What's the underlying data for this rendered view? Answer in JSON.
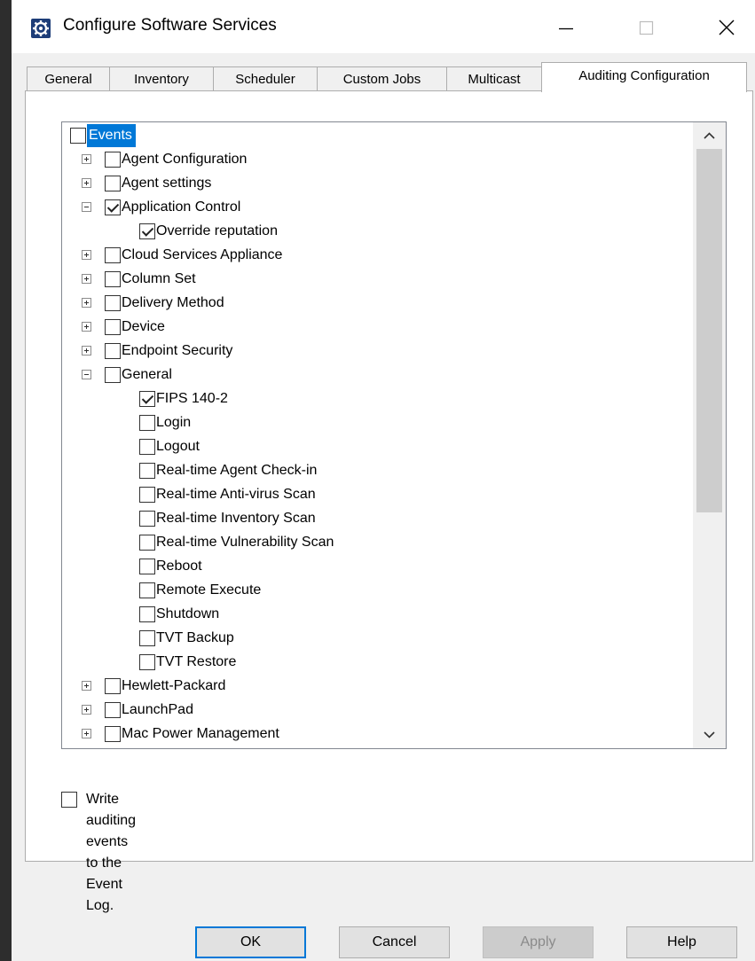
{
  "window": {
    "title": "Configure Software Services",
    "controls": {
      "minimize": "minimize-icon",
      "maximize": "maximize-icon",
      "close": "close-icon"
    }
  },
  "tabs": [
    {
      "label": "General"
    },
    {
      "label": "Inventory"
    },
    {
      "label": "Scheduler"
    },
    {
      "label": "Custom Jobs"
    },
    {
      "label": "Multicast"
    },
    {
      "label": "Auditing Configuration",
      "active": true
    }
  ],
  "tree": {
    "items": [
      {
        "label": "Events",
        "level": 0,
        "checked": false,
        "selected": true
      },
      {
        "label": "Agent Configuration",
        "level": 1,
        "expander": "plus",
        "checked": false
      },
      {
        "label": "Agent settings",
        "level": 1,
        "expander": "plus",
        "checked": false
      },
      {
        "label": "Application Control",
        "level": 1,
        "expander": "minus",
        "checked": true
      },
      {
        "label": "Override reputation",
        "level": 2,
        "checked": true
      },
      {
        "label": "Cloud Services Appliance",
        "level": 1,
        "expander": "plus",
        "checked": false
      },
      {
        "label": "Column Set",
        "level": 1,
        "expander": "plus",
        "checked": false
      },
      {
        "label": "Delivery Method",
        "level": 1,
        "expander": "plus",
        "checked": false
      },
      {
        "label": "Device",
        "level": 1,
        "expander": "plus",
        "checked": false
      },
      {
        "label": "Endpoint Security",
        "level": 1,
        "expander": "plus",
        "checked": false
      },
      {
        "label": "General",
        "level": 1,
        "expander": "minus",
        "checked": false
      },
      {
        "label": "FIPS 140-2",
        "level": 2,
        "checked": true
      },
      {
        "label": "Login",
        "level": 2,
        "checked": false
      },
      {
        "label": "Logout",
        "level": 2,
        "checked": false
      },
      {
        "label": "Real-time Agent Check-in",
        "level": 2,
        "checked": false
      },
      {
        "label": "Real-time Anti-virus Scan",
        "level": 2,
        "checked": false
      },
      {
        "label": "Real-time Inventory Scan",
        "level": 2,
        "checked": false
      },
      {
        "label": "Real-time Vulnerability Scan",
        "level": 2,
        "checked": false
      },
      {
        "label": "Reboot",
        "level": 2,
        "checked": false
      },
      {
        "label": "Remote Execute",
        "level": 2,
        "checked": false
      },
      {
        "label": "Shutdown",
        "level": 2,
        "checked": false
      },
      {
        "label": "TVT Backup",
        "level": 2,
        "checked": false
      },
      {
        "label": "TVT Restore",
        "level": 2,
        "checked": false
      },
      {
        "label": "Hewlett-Packard",
        "level": 1,
        "expander": "plus",
        "checked": false
      },
      {
        "label": "LaunchPad",
        "level": 1,
        "expander": "plus",
        "checked": false
      },
      {
        "label": "Mac Power Management",
        "level": 1,
        "expander": "plus",
        "checked": false
      }
    ]
  },
  "eventlog": {
    "label": "Write auditing events to the Event Log.",
    "checked": false
  },
  "buttons": {
    "ok": "OK",
    "cancel": "Cancel",
    "apply": "Apply",
    "help": "Help"
  },
  "colors": {
    "selection": "#0078d7",
    "titlebar": "#ffffff",
    "dialog": "#f0f0f0"
  }
}
